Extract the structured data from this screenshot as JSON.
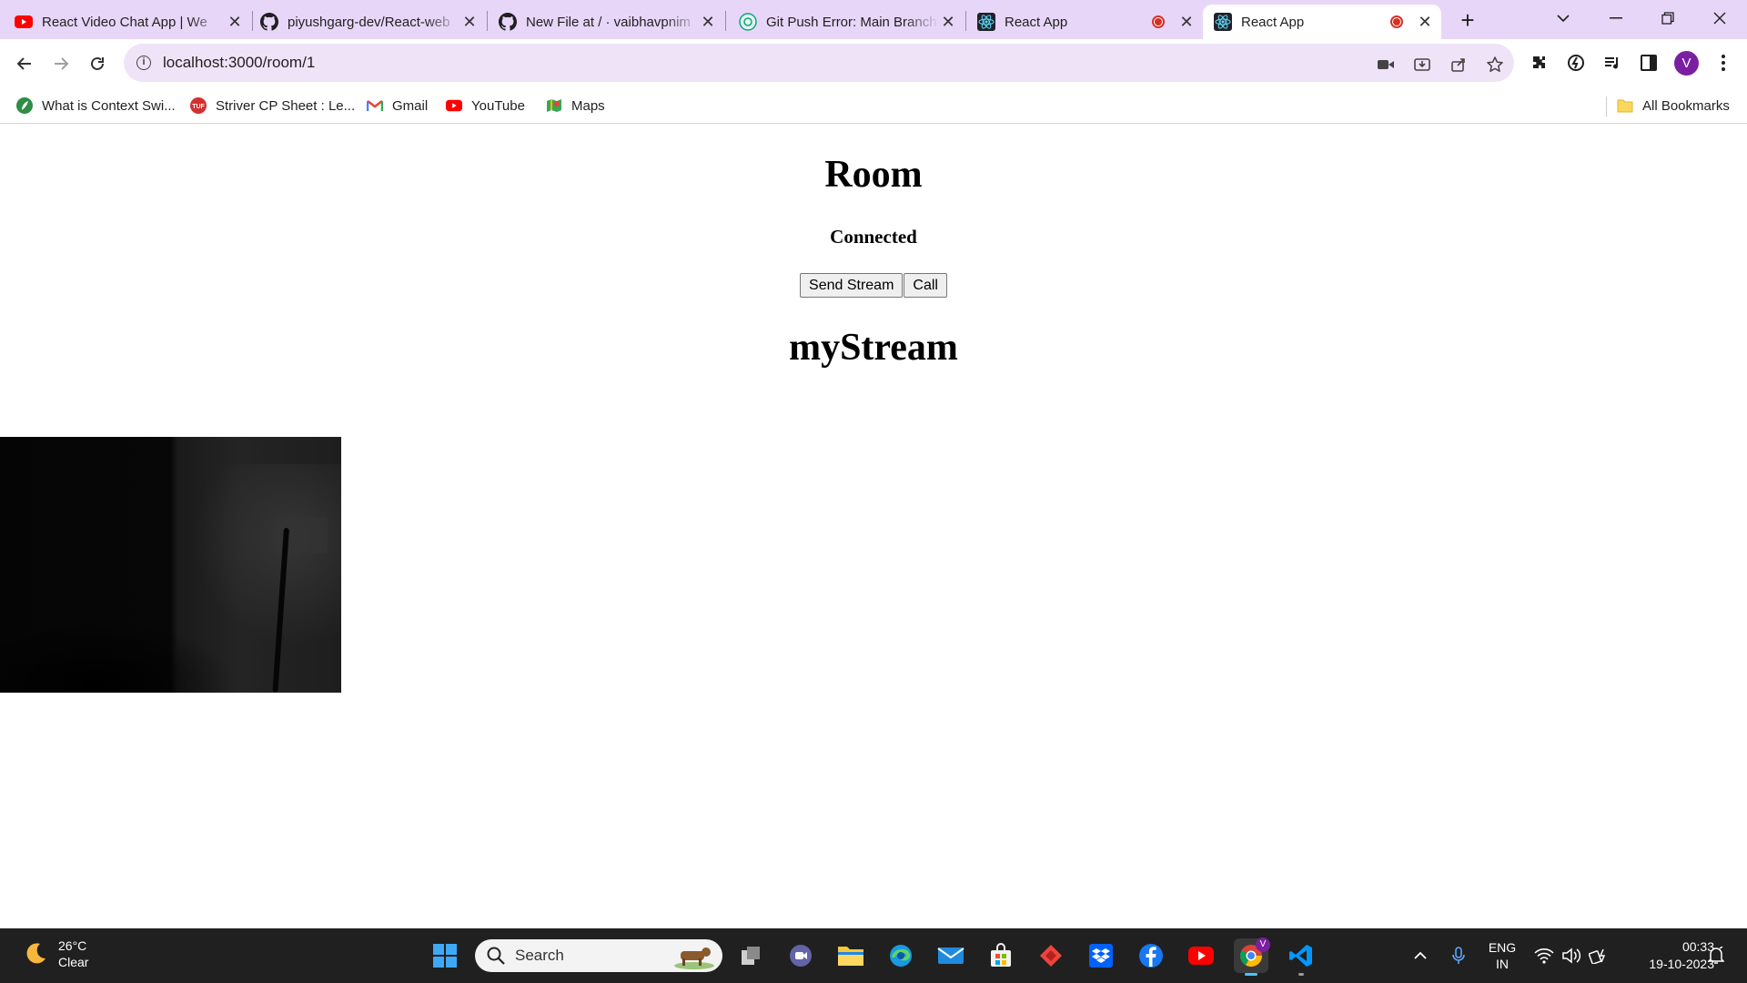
{
  "browser": {
    "tabs": [
      {
        "title": "React Video Chat App | We",
        "favicon": "youtube-icon"
      },
      {
        "title": "piyushgarg-dev/React-web",
        "favicon": "github-icon"
      },
      {
        "title": "New File at / · vaibhavpnim",
        "favicon": "github-icon"
      },
      {
        "title": "Git Push Error: Main Branch",
        "favicon": "chatgpt-icon"
      },
      {
        "title": "React App",
        "favicon": "react-icon",
        "recording": true
      },
      {
        "title": "React App",
        "favicon": "react-icon",
        "recording": true,
        "active": true
      }
    ],
    "url": "localhost:3000/room/1",
    "profile_initial": "V",
    "bookmarks": [
      {
        "label": "What is Context Swi...",
        "icon": "green-leaf-icon"
      },
      {
        "label": "Striver CP Sheet : Le...",
        "icon": "tuf-icon"
      },
      {
        "label": "Gmail",
        "icon": "gmail-icon"
      },
      {
        "label": "YouTube",
        "icon": "youtube-icon"
      },
      {
        "label": "Maps",
        "icon": "maps-icon"
      }
    ],
    "all_bookmarks_label": "All Bookmarks"
  },
  "page": {
    "heading": "Room",
    "status": "Connected",
    "send_stream_label": "Send Stream",
    "call_label": "Call",
    "stream_heading": "myStream"
  },
  "taskbar": {
    "weather_temp": "26°C",
    "weather_desc": "Clear",
    "search_placeholder": "Search",
    "language": "ENG",
    "region": "IN",
    "time": "00:33",
    "date": "19-10-2023",
    "chrome_badge": "V"
  },
  "colors": {
    "tabstrip": "#e8d6f8",
    "omnibox": "#efe4f7",
    "taskbar": "#202020",
    "recording": "#d93025",
    "avatar": "#7b1fa2"
  }
}
